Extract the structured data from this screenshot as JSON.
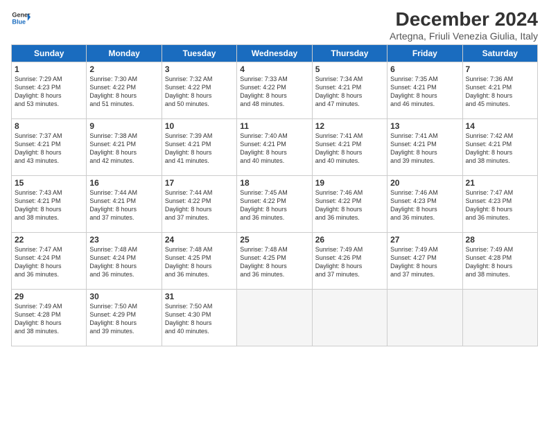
{
  "logo": {
    "line1": "General",
    "line2": "Blue"
  },
  "title": "December 2024",
  "subtitle": "Artegna, Friuli Venezia Giulia, Italy",
  "headers": [
    "Sunday",
    "Monday",
    "Tuesday",
    "Wednesday",
    "Thursday",
    "Friday",
    "Saturday"
  ],
  "weeks": [
    [
      {
        "day": "1",
        "lines": [
          "Sunrise: 7:29 AM",
          "Sunset: 4:23 PM",
          "Daylight: 8 hours",
          "and 53 minutes."
        ]
      },
      {
        "day": "2",
        "lines": [
          "Sunrise: 7:30 AM",
          "Sunset: 4:22 PM",
          "Daylight: 8 hours",
          "and 51 minutes."
        ]
      },
      {
        "day": "3",
        "lines": [
          "Sunrise: 7:32 AM",
          "Sunset: 4:22 PM",
          "Daylight: 8 hours",
          "and 50 minutes."
        ]
      },
      {
        "day": "4",
        "lines": [
          "Sunrise: 7:33 AM",
          "Sunset: 4:22 PM",
          "Daylight: 8 hours",
          "and 48 minutes."
        ]
      },
      {
        "day": "5",
        "lines": [
          "Sunrise: 7:34 AM",
          "Sunset: 4:21 PM",
          "Daylight: 8 hours",
          "and 47 minutes."
        ]
      },
      {
        "day": "6",
        "lines": [
          "Sunrise: 7:35 AM",
          "Sunset: 4:21 PM",
          "Daylight: 8 hours",
          "and 46 minutes."
        ]
      },
      {
        "day": "7",
        "lines": [
          "Sunrise: 7:36 AM",
          "Sunset: 4:21 PM",
          "Daylight: 8 hours",
          "and 45 minutes."
        ]
      }
    ],
    [
      {
        "day": "8",
        "lines": [
          "Sunrise: 7:37 AM",
          "Sunset: 4:21 PM",
          "Daylight: 8 hours",
          "and 43 minutes."
        ]
      },
      {
        "day": "9",
        "lines": [
          "Sunrise: 7:38 AM",
          "Sunset: 4:21 PM",
          "Daylight: 8 hours",
          "and 42 minutes."
        ]
      },
      {
        "day": "10",
        "lines": [
          "Sunrise: 7:39 AM",
          "Sunset: 4:21 PM",
          "Daylight: 8 hours",
          "and 41 minutes."
        ]
      },
      {
        "day": "11",
        "lines": [
          "Sunrise: 7:40 AM",
          "Sunset: 4:21 PM",
          "Daylight: 8 hours",
          "and 40 minutes."
        ]
      },
      {
        "day": "12",
        "lines": [
          "Sunrise: 7:41 AM",
          "Sunset: 4:21 PM",
          "Daylight: 8 hours",
          "and 40 minutes."
        ]
      },
      {
        "day": "13",
        "lines": [
          "Sunrise: 7:41 AM",
          "Sunset: 4:21 PM",
          "Daylight: 8 hours",
          "and 39 minutes."
        ]
      },
      {
        "day": "14",
        "lines": [
          "Sunrise: 7:42 AM",
          "Sunset: 4:21 PM",
          "Daylight: 8 hours",
          "and 38 minutes."
        ]
      }
    ],
    [
      {
        "day": "15",
        "lines": [
          "Sunrise: 7:43 AM",
          "Sunset: 4:21 PM",
          "Daylight: 8 hours",
          "and 38 minutes."
        ]
      },
      {
        "day": "16",
        "lines": [
          "Sunrise: 7:44 AM",
          "Sunset: 4:21 PM",
          "Daylight: 8 hours",
          "and 37 minutes."
        ]
      },
      {
        "day": "17",
        "lines": [
          "Sunrise: 7:44 AM",
          "Sunset: 4:22 PM",
          "Daylight: 8 hours",
          "and 37 minutes."
        ]
      },
      {
        "day": "18",
        "lines": [
          "Sunrise: 7:45 AM",
          "Sunset: 4:22 PM",
          "Daylight: 8 hours",
          "and 36 minutes."
        ]
      },
      {
        "day": "19",
        "lines": [
          "Sunrise: 7:46 AM",
          "Sunset: 4:22 PM",
          "Daylight: 8 hours",
          "and 36 minutes."
        ]
      },
      {
        "day": "20",
        "lines": [
          "Sunrise: 7:46 AM",
          "Sunset: 4:23 PM",
          "Daylight: 8 hours",
          "and 36 minutes."
        ]
      },
      {
        "day": "21",
        "lines": [
          "Sunrise: 7:47 AM",
          "Sunset: 4:23 PM",
          "Daylight: 8 hours",
          "and 36 minutes."
        ]
      }
    ],
    [
      {
        "day": "22",
        "lines": [
          "Sunrise: 7:47 AM",
          "Sunset: 4:24 PM",
          "Daylight: 8 hours",
          "and 36 minutes."
        ]
      },
      {
        "day": "23",
        "lines": [
          "Sunrise: 7:48 AM",
          "Sunset: 4:24 PM",
          "Daylight: 8 hours",
          "and 36 minutes."
        ]
      },
      {
        "day": "24",
        "lines": [
          "Sunrise: 7:48 AM",
          "Sunset: 4:25 PM",
          "Daylight: 8 hours",
          "and 36 minutes."
        ]
      },
      {
        "day": "25",
        "lines": [
          "Sunrise: 7:48 AM",
          "Sunset: 4:25 PM",
          "Daylight: 8 hours",
          "and 36 minutes."
        ]
      },
      {
        "day": "26",
        "lines": [
          "Sunrise: 7:49 AM",
          "Sunset: 4:26 PM",
          "Daylight: 8 hours",
          "and 37 minutes."
        ]
      },
      {
        "day": "27",
        "lines": [
          "Sunrise: 7:49 AM",
          "Sunset: 4:27 PM",
          "Daylight: 8 hours",
          "and 37 minutes."
        ]
      },
      {
        "day": "28",
        "lines": [
          "Sunrise: 7:49 AM",
          "Sunset: 4:28 PM",
          "Daylight: 8 hours",
          "and 38 minutes."
        ]
      }
    ],
    [
      {
        "day": "29",
        "lines": [
          "Sunrise: 7:49 AM",
          "Sunset: 4:28 PM",
          "Daylight: 8 hours",
          "and 38 minutes."
        ]
      },
      {
        "day": "30",
        "lines": [
          "Sunrise: 7:50 AM",
          "Sunset: 4:29 PM",
          "Daylight: 8 hours",
          "and 39 minutes."
        ]
      },
      {
        "day": "31",
        "lines": [
          "Sunrise: 7:50 AM",
          "Sunset: 4:30 PM",
          "Daylight: 8 hours",
          "and 40 minutes."
        ]
      },
      null,
      null,
      null,
      null
    ]
  ]
}
